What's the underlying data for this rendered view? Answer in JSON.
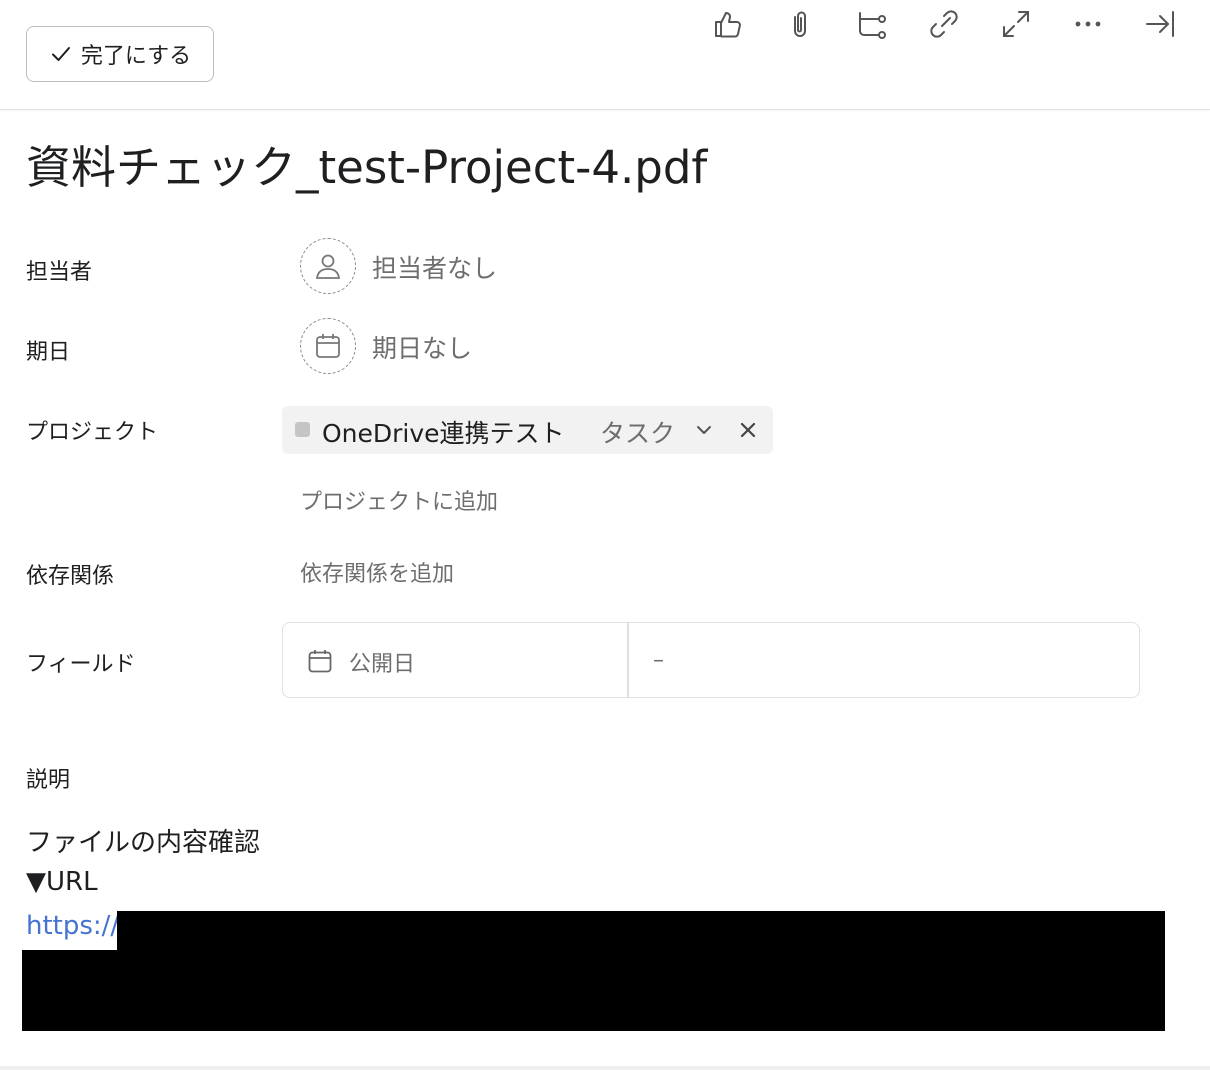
{
  "header": {
    "complete_button_label": "完了にする",
    "toolbar_icons": [
      "like-icon",
      "attachment-icon",
      "subtask-icon",
      "link-icon",
      "expand-icon",
      "more-icon",
      "close-pane-icon"
    ]
  },
  "task": {
    "title": "資料チェック_test-Project-4.pdf"
  },
  "fields": {
    "assignee": {
      "label": "担当者",
      "value": "担当者なし"
    },
    "due_date": {
      "label": "期日",
      "value": "期日なし"
    },
    "projects": {
      "label": "プロジェクト",
      "items": [
        {
          "name": "OneDrive連携テスト",
          "section": "タスク",
          "color": "#c5c5c5"
        }
      ],
      "add_label": "プロジェクトに追加"
    },
    "dependencies": {
      "label": "依存関係",
      "add_label": "依存関係を追加"
    },
    "custom_fields": {
      "label": "フィールド",
      "items": [
        {
          "name": "公開日",
          "value": "–"
        }
      ]
    }
  },
  "description": {
    "label": "説明",
    "lines": [
      "ファイルの内容確認",
      "▼URL"
    ],
    "link_text": "https://"
  },
  "colors": {
    "link": "#4573d2",
    "muted_text": "#6d6e6f",
    "primary_text": "#1e1f21",
    "pill_background": "#f2f2f2"
  }
}
